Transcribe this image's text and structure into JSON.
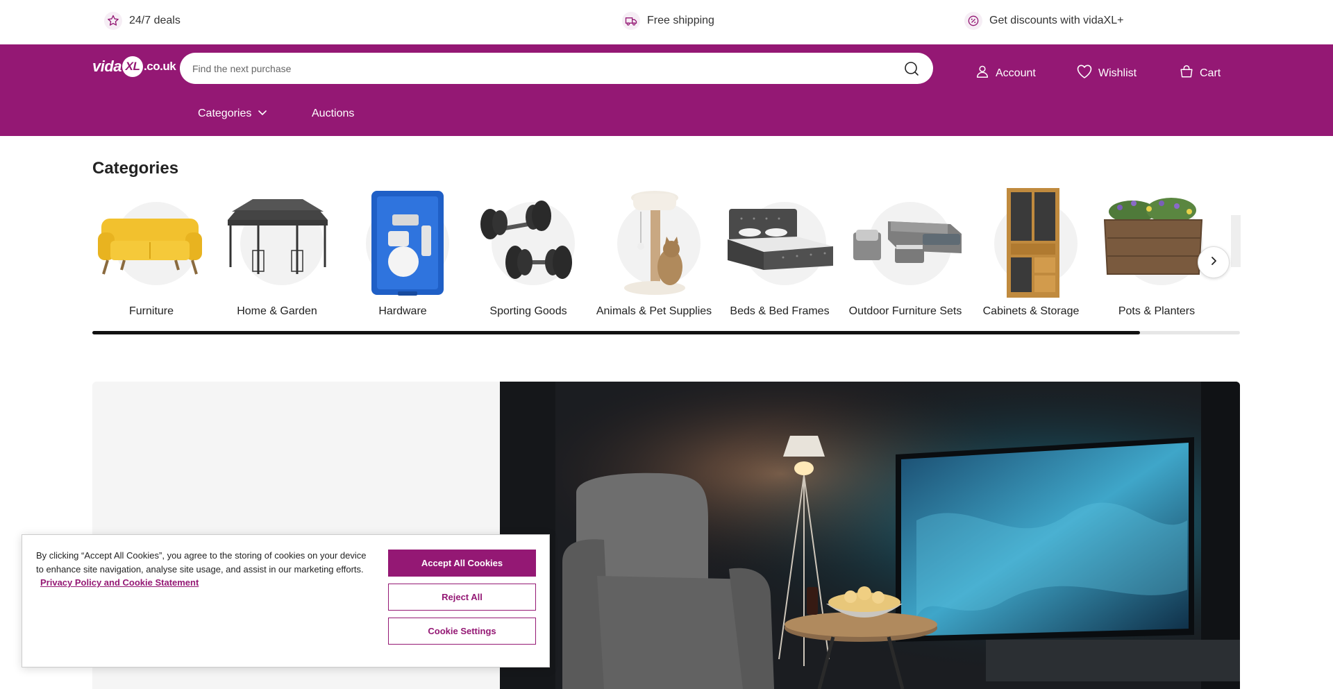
{
  "usp": [
    {
      "icon": "star-icon",
      "text": "24/7 deals"
    },
    {
      "icon": "delivery-truck-icon",
      "text": "Free shipping"
    },
    {
      "icon": "discount-percent-icon",
      "text": "Get discounts with vidaXL+"
    }
  ],
  "header": {
    "logo": {
      "prefix": "vida",
      "badge": "XL",
      "suffix": ".co.uk"
    },
    "search_placeholder": "Find the next purchase",
    "account_label": "Account",
    "wishlist_label": "Wishlist",
    "cart_label": "Cart",
    "nav": {
      "categories_label": "Categories",
      "auctions_label": "Auctions"
    }
  },
  "categories": {
    "title": "Categories",
    "items": [
      {
        "label": "Furniture",
        "icon": "sofa-icon"
      },
      {
        "label": "Home & Garden",
        "icon": "gazebo-icon"
      },
      {
        "label": "Hardware",
        "icon": "toolcase-icon"
      },
      {
        "label": "Sporting Goods",
        "icon": "dumbbell-icon"
      },
      {
        "label": "Animals & Pet Supplies",
        "icon": "cat-tree-icon"
      },
      {
        "label": "Beds & Bed Frames",
        "icon": "bed-icon"
      },
      {
        "label": "Outdoor Furniture Sets",
        "icon": "lounge-set-icon"
      },
      {
        "label": "Cabinets & Storage",
        "icon": "cabinet-icon"
      },
      {
        "label": "Pots & Planters",
        "icon": "planter-icon"
      }
    ],
    "scroll_progress": 0.913
  },
  "cookie_banner": {
    "text": "By clicking “Accept All Cookies”, you agree to the storing of cookies on your device to enhance site navigation, analyse site usage, and assist in our marketing efforts.",
    "link_label": "Privacy Policy and Cookie Statement",
    "accept_label": "Accept All Cookies",
    "reject_label": "Reject All",
    "settings_label": "Cookie Settings"
  },
  "colors": {
    "brand": "#941874",
    "hero_glow": "#1fb3d9"
  }
}
